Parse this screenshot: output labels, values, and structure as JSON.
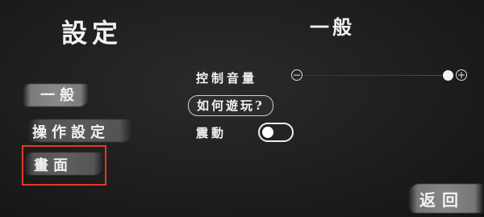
{
  "header": {
    "title": "設定",
    "section_title": "一般"
  },
  "sidebar": {
    "items": [
      {
        "label": "一般",
        "active": true
      },
      {
        "label": "操作設定",
        "active": false
      },
      {
        "label": "畫面",
        "active": false,
        "highlighted": true
      }
    ],
    "highlight_color": "#e23a2a"
  },
  "settings": {
    "volume": {
      "label": "控制音量",
      "minus_icon": "minus-circle-icon",
      "plus_icon": "plus-circle-icon",
      "level": 1.0
    },
    "howto": {
      "label": "如何遊玩?"
    },
    "vibration": {
      "label": "震動",
      "enabled": false
    }
  },
  "footer": {
    "back_label": "返回"
  }
}
